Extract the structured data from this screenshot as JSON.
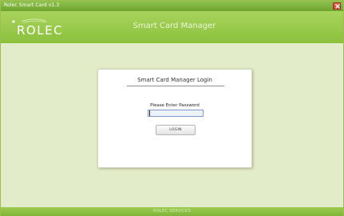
{
  "window": {
    "title": "Rolec Smart Card v1.3"
  },
  "header": {
    "logo_text": "ROLEC",
    "title": "Smart Card Manager"
  },
  "dialog": {
    "title": "Smart Card Manager Login",
    "password_label": "Please Enter Password",
    "password_value": "",
    "login_label": "LOGIN"
  },
  "footer": {
    "text": "ROLEC SERVICES"
  },
  "colors": {
    "accent": "#8bc03c",
    "background": "#e3ecc8",
    "close": "#c33a2a"
  }
}
